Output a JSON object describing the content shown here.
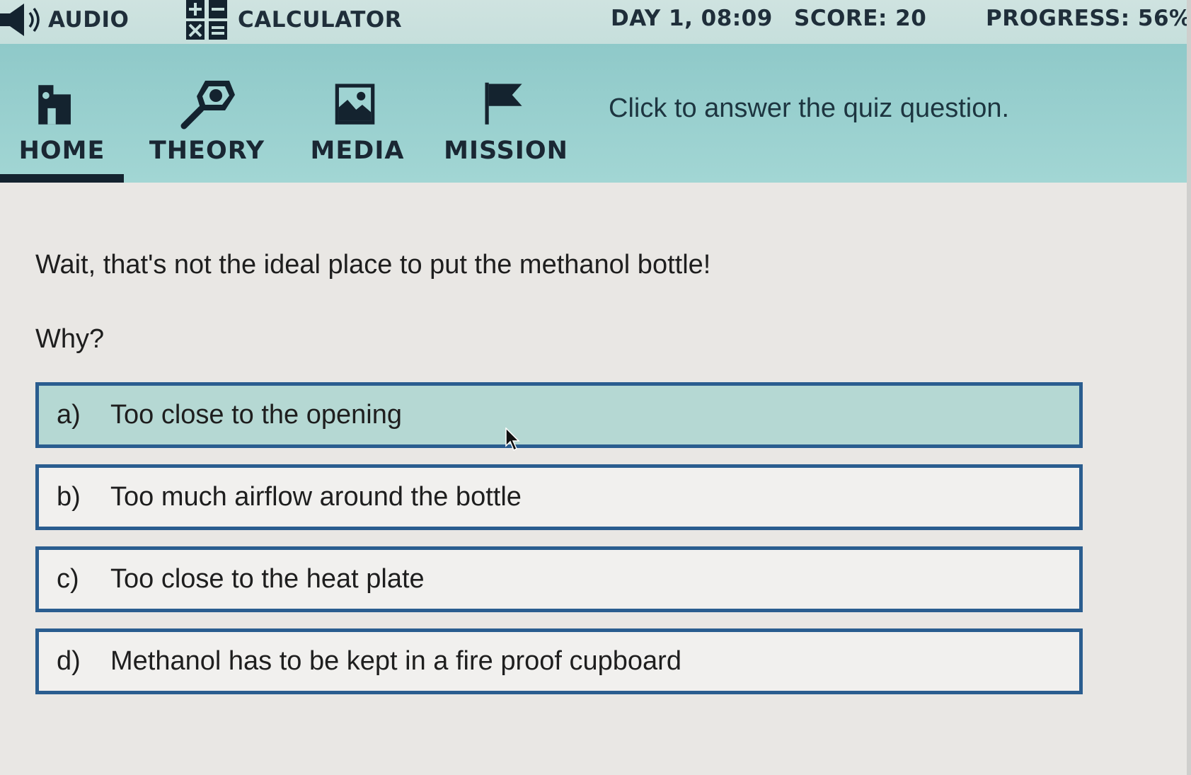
{
  "statusbar": {
    "audio_label": "AUDIO",
    "calculator_label": "CALCULATOR",
    "day_time": "DAY 1, 08:09",
    "score": "SCORE: 20",
    "progress": "PROGRESS: 56%"
  },
  "nav": {
    "items": [
      {
        "label": "HOME",
        "icon": "home-icon",
        "active": true
      },
      {
        "label": "THEORY",
        "icon": "magnifier-icon",
        "active": false
      },
      {
        "label": "MEDIA",
        "icon": "image-icon",
        "active": false
      },
      {
        "label": "MISSION",
        "icon": "flag-icon",
        "active": false
      }
    ],
    "hint": "Click to answer the quiz question."
  },
  "quiz": {
    "prompt": "Wait, that's not the ideal place to put the methanol bottle!",
    "question": "Why?",
    "answers": [
      {
        "letter": "a)",
        "text": "Too close to the opening",
        "highlighted": true
      },
      {
        "letter": "b)",
        "text": "Too much airflow around the bottle",
        "highlighted": false
      },
      {
        "letter": "c)",
        "text": "Too close to the heat plate",
        "highlighted": false
      },
      {
        "letter": "d)",
        "text": "Methanol has to be kept in a fire proof cupboard",
        "highlighted": false
      }
    ]
  },
  "colors": {
    "statusbar_bg": "#c6dfdc",
    "navbar_bg": "#9dd2d1",
    "answer_border": "#2a5d8f",
    "answer_highlight": "#b5d8d3",
    "text_dark": "#1a2733"
  }
}
